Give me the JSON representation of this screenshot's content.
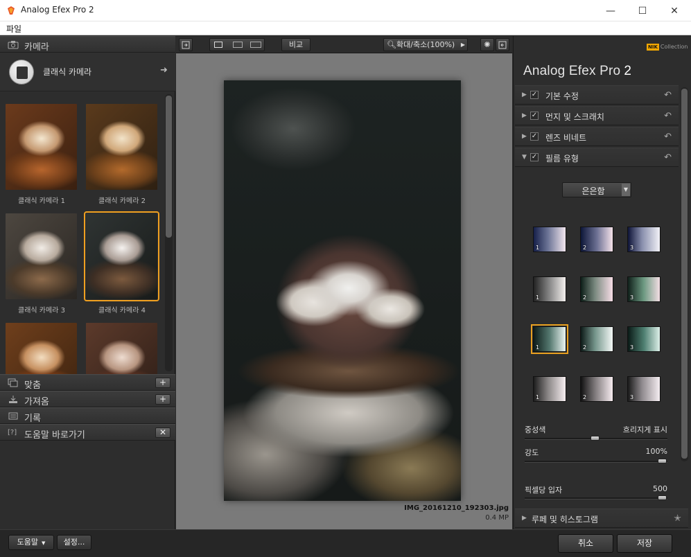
{
  "window": {
    "title": "Analog Efex Pro 2",
    "minimize": "—",
    "maximize": "☐",
    "close": "✕"
  },
  "menu": {
    "file": "파일"
  },
  "left": {
    "camera_header": "카메라",
    "camera_selector": "클래식 카메라",
    "thumbnails": [
      {
        "label": "클래식 카메라 1"
      },
      {
        "label": "클래식 카메라 2"
      },
      {
        "label": "클래식 카메라 3"
      },
      {
        "label": "클래식 카메라 4"
      }
    ],
    "sections": [
      {
        "label": "맞춤",
        "button": "+"
      },
      {
        "label": "가져옴",
        "button": "+"
      },
      {
        "label": "기록",
        "button": ""
      },
      {
        "label": "도움말 바로가기",
        "button": "✕"
      }
    ]
  },
  "toolbar": {
    "compare": "비교",
    "zoom": "확대/축소(100%)"
  },
  "image": {
    "filename": "IMG_20161210_192303.jpg",
    "size": "0.4 MP"
  },
  "right": {
    "logo_text": "Collection",
    "logo_badge": "NIK",
    "app_name": "Analog Efex Pro",
    "app_version": "2",
    "filters": [
      {
        "label": "기본 수정",
        "expanded": false
      },
      {
        "label": "먼지 및 스크래치",
        "expanded": false
      },
      {
        "label": "렌즈 비네트",
        "expanded": false
      },
      {
        "label": "필름 유형",
        "expanded": true
      }
    ],
    "film_dropdown": "은은함",
    "swatches": [
      "1",
      "2",
      "3",
      "1",
      "2",
      "3",
      "1",
      "2",
      "3",
      "1",
      "2",
      "3"
    ],
    "neutral_label": "중성색",
    "neutral_value": "흐리지게 표시",
    "strength_label": "강도",
    "strength_value": "100%",
    "grain_label": "픽셀당 입자",
    "grain_value": "500",
    "loupe_label": "루페 및 히스토그램"
  },
  "bottom": {
    "help": "도움말",
    "settings": "설정...",
    "cancel": "취소",
    "save": "저장"
  },
  "colors": {
    "accent": "#f0a020",
    "panel_bg": "#2d2d2d",
    "canvas_bg": "#7a7a7a"
  }
}
